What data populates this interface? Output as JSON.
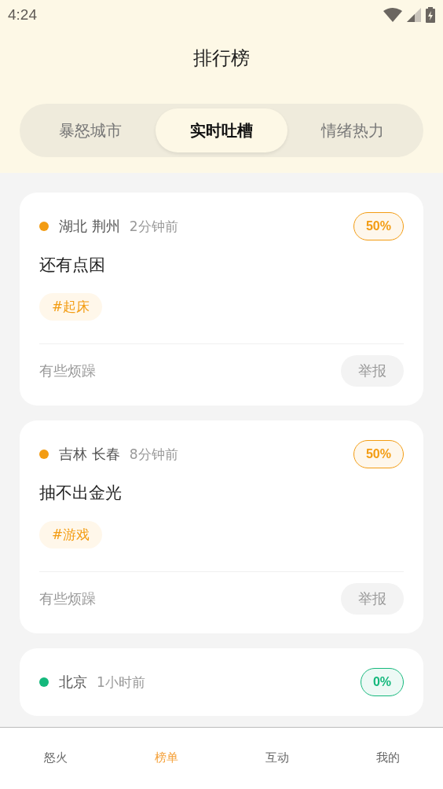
{
  "status_bar": {
    "time": "4:24"
  },
  "title": "排行榜",
  "tabs": [
    {
      "label": "暴怒城市",
      "selected": false
    },
    {
      "label": "实时吐槽",
      "selected": true
    },
    {
      "label": "情绪热力",
      "selected": false
    }
  ],
  "posts": [
    {
      "location": "湖北 荆州",
      "time": "2分钟前",
      "percent": "50%",
      "color": "#f39c12",
      "text": "还有点困",
      "tag": "#起床",
      "mood": "有些烦躁",
      "report": "举报"
    },
    {
      "location": "吉林 长春",
      "time": "8分钟前",
      "percent": "50%",
      "color": "#f39c12",
      "text": "抽不出金光",
      "tag": "#游戏",
      "mood": "有些烦躁",
      "report": "举报"
    },
    {
      "location": "北京",
      "time": "1小时前",
      "percent": "0%",
      "color": "#14b87c"
    }
  ],
  "bottom_nav": [
    {
      "label": "怒火",
      "selected": false
    },
    {
      "label": "榜单",
      "selected": true
    },
    {
      "label": "互动",
      "selected": false
    },
    {
      "label": "我的",
      "selected": false
    }
  ]
}
